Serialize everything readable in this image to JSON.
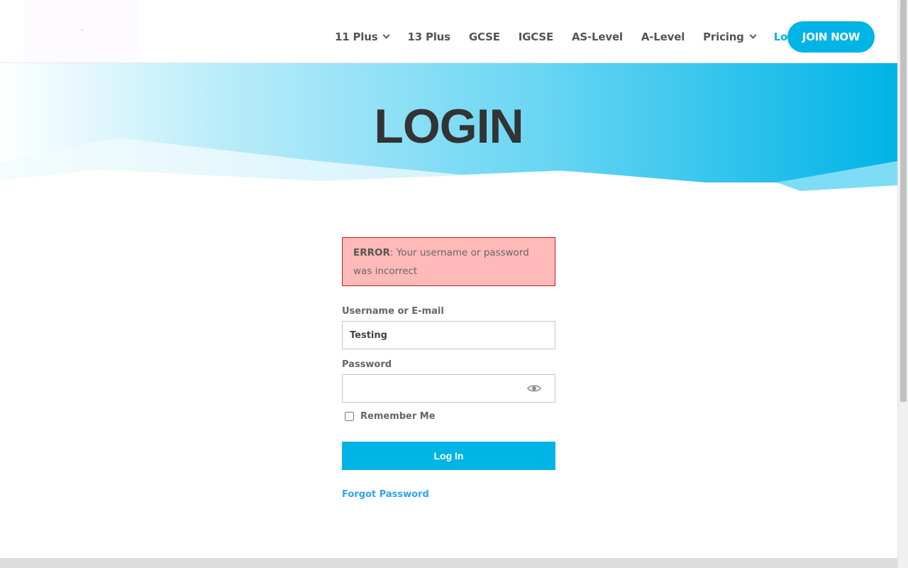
{
  "header": {
    "logo_icon": "site-logo",
    "nav": [
      {
        "label": "11 Plus",
        "has_dropdown": true
      },
      {
        "label": "13 Plus",
        "has_dropdown": false
      },
      {
        "label": "GCSE",
        "has_dropdown": false
      },
      {
        "label": "IGCSE",
        "has_dropdown": false
      },
      {
        "label": "AS-Level",
        "has_dropdown": false
      },
      {
        "label": "A-Level",
        "has_dropdown": false
      },
      {
        "label": "Pricing",
        "has_dropdown": true
      },
      {
        "label": "Login",
        "has_dropdown": false,
        "active": true
      }
    ],
    "join_label": "JOIN NOW"
  },
  "hero": {
    "title": "LOGIN"
  },
  "form": {
    "error_prefix": "ERROR",
    "error_message": ": Your username or password was incorrect",
    "username_label": "Username or E-mail",
    "username_value": "Testing",
    "password_label": "Password",
    "password_value": "",
    "show_password_icon": "eye-icon",
    "remember_label": "Remember Me",
    "remember_checked": false,
    "submit_label": "Log In",
    "forgot_label": "Forgot Password"
  },
  "colors": {
    "accent": "#00b4e6",
    "link": "#2ea3f2",
    "error_bg": "#ffb9b9",
    "error_border": "#c0201c",
    "text": "#666666",
    "title": "#333333"
  }
}
